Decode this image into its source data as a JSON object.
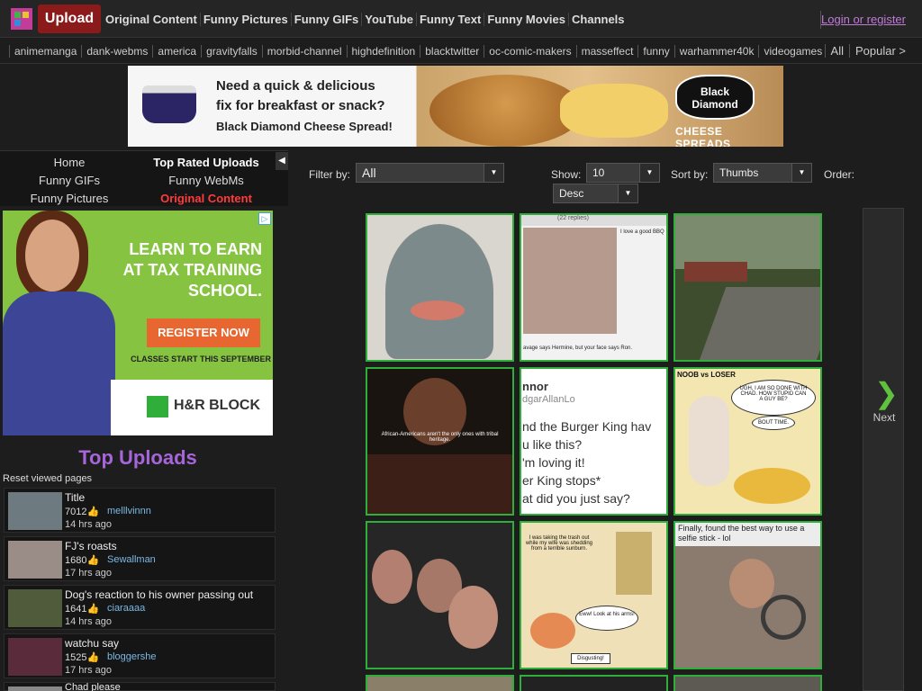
{
  "header": {
    "upload_label": "Upload",
    "nav": [
      "Original Content",
      "Funny Pictures",
      "Funny GIFs",
      "YouTube",
      "Funny Text",
      "Funny Movies",
      "Channels"
    ],
    "login_label": "Login or register"
  },
  "channels": {
    "items": [
      "animemanga",
      "dank-webms",
      "america",
      "gravityfalls",
      "morbid-channel",
      "highdefinition",
      "blacktwitter",
      "oc-comic-makers",
      "masseffect",
      "funny",
      "warhammer40k",
      "videogames"
    ],
    "all_label": "All",
    "popular_label": "Popular >"
  },
  "banner_ad": {
    "line1": "Need a quick & delicious",
    "line2": "fix for breakfast or snack?",
    "line3": "Black Diamond Cheese Spread!",
    "logo_line1": "Black",
    "logo_line2": "Diamond",
    "sub": "CHEESE SPREADS"
  },
  "sidenav": {
    "home": "Home",
    "top_rated": "Top Rated Uploads",
    "funny_gifs": "Funny GIFs",
    "funny_webms": "Funny WebMs",
    "funny_pictures": "Funny Pictures",
    "original_content": "Original Content"
  },
  "side_ad": {
    "headline1": "LEARN TO EARN",
    "headline2": "AT TAX TRAINING",
    "headline3": "SCHOOL.",
    "cta": "REGISTER NOW",
    "classes": "CLASSES START THIS SEPTEMBER",
    "brand": "H&R BLOCK"
  },
  "top_uploads": {
    "title": "Top Uploads",
    "reset_label": "Reset viewed pages",
    "items": [
      {
        "title": "Title",
        "thumbs": "7012",
        "user": "melllvinnn",
        "age": "14 hrs ago"
      },
      {
        "title": "FJ's roasts",
        "thumbs": "1680",
        "user": "Sewallman",
        "age": "17 hrs ago"
      },
      {
        "title": "Dog's reaction to his owner passing out",
        "thumbs": "1641",
        "user": "ciaraaaa",
        "age": "14 hrs ago"
      },
      {
        "title": "watchu say",
        "thumbs": "1525",
        "user": "bloggershe",
        "age": "17 hrs ago"
      },
      {
        "title": "Chad please",
        "thumbs": "",
        "user": "",
        "age": ""
      }
    ]
  },
  "filters": {
    "filter_label": "Filter by:",
    "filter_value": "All",
    "show_label": "Show:",
    "show_value": "10",
    "sort_label": "Sort by:",
    "sort_value": "Thumbs",
    "order_label": "Order:",
    "order_value": "Desc"
  },
  "grid": {
    "replies": "(22 replies)",
    "bbq": "I love a good BBQ",
    "hermione": "avage says Hermine, but your face says Ron.",
    "tribal": "African-Americans aren't the only ones with tribal heritage.",
    "bk_name": "nnor",
    "bk_handle": "dgarAllanLo",
    "bk_lines": [
      "nd the Burger King hav",
      "u like this?",
      "'m loving it!",
      "er King stops*",
      "at did you just say?"
    ],
    "noob": "NOOB vs LOSER",
    "ugh": "UGH, I AM SO DONE WITH CHAD. HOW STUPID CAN A GUY BE?",
    "bout_time": "BOUT TIME.",
    "shower": "I was taking the trash out while my wife was shedding from a terrible sunburn.",
    "eww": "Eww! Look at his arms!",
    "disgusting": "Disgusting!",
    "selfie": "Finally, found the best way to use a selfie stick - lol"
  },
  "next_label": "Next"
}
